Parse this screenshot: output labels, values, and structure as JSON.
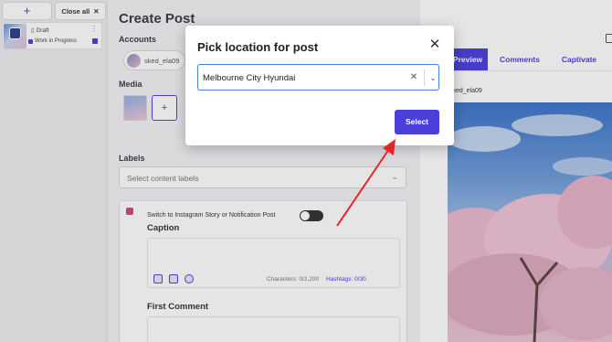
{
  "sidebar": {
    "add_label": "+",
    "close_all_label": "Close all",
    "draft": {
      "status_label": "Draft",
      "menu_label": "⋮",
      "tag_label": "Work in Progress"
    }
  },
  "main": {
    "title": "Create Post",
    "accounts_label": "Accounts",
    "account_name": "sked_ela09",
    "media_label": "Media",
    "media_add_label": "+",
    "labels_label": "Labels",
    "labels_placeholder": "Select content labels",
    "switch_label": "Switch to Instagram Story or Notification Post",
    "caption_label": "Caption",
    "characters_label": "Characters: 0/2,200",
    "hashtags_label": "Hashtags: 0/30",
    "first_comment_label": "First Comment"
  },
  "preview": {
    "tabs": [
      {
        "label": "Preview"
      },
      {
        "label": "Comments"
      },
      {
        "label": "Captivate"
      }
    ],
    "username": "sked_ela09"
  },
  "modal": {
    "title": "Pick location for post",
    "location_value": "Melbourne City Hyundai",
    "select_label": "Select"
  },
  "colors": {
    "accent": "#4b3fdc",
    "annotation_arrow": "#e8242a"
  },
  "icons": {
    "modal_close": "close-icon",
    "clear": "clear-icon",
    "dropdown": "chevron-down-icon",
    "close_all": "close-icon"
  }
}
